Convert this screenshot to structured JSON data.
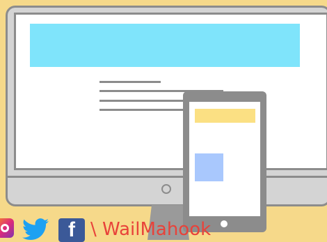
{
  "illustration": {
    "colors": {
      "background": "#f6d98a",
      "monitor_frame": "#d4d4d4",
      "monitor_outline": "#8c8c8c",
      "desktop_banner": "#7fe4fb",
      "phone_header": "#fbe083",
      "phone_image": "#a9c8fd"
    }
  },
  "social": {
    "icons": [
      "instagram-icon",
      "twitter-icon",
      "facebook-icon"
    ],
    "facebook_glyph": "f",
    "brand_text": "\\ WailMahook"
  }
}
